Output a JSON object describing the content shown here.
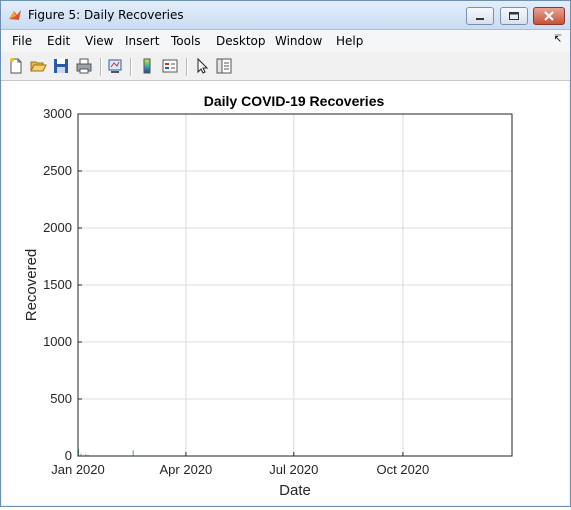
{
  "window": {
    "title": "Figure 5: Daily Recoveries"
  },
  "menu": [
    "File",
    "Edit",
    "View",
    "Insert",
    "Tools",
    "Desktop",
    "Window",
    "Help"
  ],
  "toolbar": {
    "icons": [
      "new-figure-icon",
      "open-file-icon",
      "save-icon",
      "print-icon",
      "link-plot-icon",
      "insert-colorbar-icon",
      "insert-legend-icon",
      "edit-plot-icon",
      "property-inspector-icon"
    ]
  },
  "colors": {
    "bars": "#3cb46e",
    "grid": "#dcdcdc",
    "axes": "#262626"
  },
  "chart_data": {
    "type": "bar",
    "title": "Daily COVID-19 Recoveries",
    "xlabel": "Date",
    "ylabel": "Recovered",
    "ylim": [
      0,
      3000
    ],
    "yticks": [
      0,
      500,
      1000,
      1500,
      2000,
      2500,
      3000
    ],
    "xlim": [
      "2020-01-01",
      "2021-01-01"
    ],
    "xticks": [
      {
        "date": "2020-01-01",
        "label": "Jan 2020"
      },
      {
        "date": "2020-04-01",
        "label": "Apr 2020"
      },
      {
        "date": "2020-07-01",
        "label": "Jul 2020"
      },
      {
        "date": "2020-10-01",
        "label": "Oct 2020"
      }
    ],
    "grid": true,
    "series": [
      {
        "start_date": "2020-01-01",
        "interval": "daily",
        "values": [
          60,
          0,
          20,
          0,
          0,
          0,
          15,
          0,
          10,
          0,
          0,
          0,
          0,
          0,
          0,
          0,
          0,
          0,
          0,
          0,
          0,
          0,
          0,
          0,
          0,
          0,
          0,
          0,
          0,
          0,
          0,
          0,
          0,
          0,
          0,
          0,
          0,
          0,
          0,
          0,
          0,
          0,
          0,
          0,
          0,
          0,
          50,
          0,
          0,
          0,
          0,
          0,
          0,
          0,
          0,
          0,
          0,
          0,
          0,
          0,
          0,
          0,
          0,
          0,
          0,
          0,
          0,
          0,
          0,
          0,
          0,
          0,
          0,
          0,
          0,
          0,
          0,
          0,
          0,
          0,
          0,
          0,
          0,
          0,
          0,
          0,
          0,
          0,
          0,
          0,
          0,
          0,
          0,
          0,
          0,
          0,
          0,
          0,
          0,
          0,
          0,
          0,
          0,
          0,
          0,
          0,
          0,
          0,
          0,
          0,
          0,
          0,
          0,
          0,
          0,
          0,
          0,
          0,
          0,
          0,
          0,
          0,
          0,
          0,
          0,
          0,
          0,
          0,
          0,
          0,
          0,
          0,
          0,
          0,
          0,
          0,
          0,
          0,
          0,
          0,
          0,
          0,
          0,
          0,
          0,
          0,
          0,
          0,
          0,
          0,
          0,
          0,
          0,
          0,
          0,
          0,
          0,
          0,
          0,
          0,
          0,
          0,
          0,
          0,
          0,
          0,
          0,
          0,
          0,
          0,
          0,
          0,
          0,
          0,
          0,
          0,
          0,
          0,
          0,
          0,
          0,
          0,
          0,
          0,
          0,
          0,
          0,
          0,
          0,
          0,
          0,
          0,
          0,
          0,
          0,
          0,
          0,
          0,
          0,
          0,
          0,
          0,
          0,
          0,
          0,
          0,
          0,
          0,
          0,
          0,
          0,
          0,
          0,
          0,
          0,
          0,
          0,
          0,
          0,
          0,
          0,
          0,
          0,
          0,
          0,
          0,
          0,
          0,
          0,
          0,
          0,
          0,
          0,
          0,
          0,
          0,
          0,
          0,
          0,
          0,
          0,
          0,
          0,
          0,
          0,
          0,
          0,
          0,
          0,
          0,
          0,
          0,
          0,
          0,
          0,
          0,
          0,
          0,
          0,
          0,
          0,
          0,
          0,
          0,
          0,
          0,
          0,
          0,
          0,
          0,
          0,
          0,
          0,
          0,
          0,
          0,
          0,
          0,
          0,
          0,
          0,
          0,
          0,
          0,
          0,
          0,
          0,
          0,
          0,
          0,
          0,
          0,
          0,
          0,
          0,
          0,
          0,
          0,
          0,
          0,
          0,
          0,
          0,
          0,
          0,
          0,
          0,
          0,
          0,
          0,
          0,
          0,
          0,
          0,
          0,
          0,
          0,
          0,
          0,
          0,
          0,
          0,
          0,
          0,
          0,
          0,
          0,
          0,
          0,
          0,
          0,
          0,
          0,
          0,
          0,
          0,
          0,
          0,
          0,
          0,
          0,
          0,
          0,
          0,
          0,
          0,
          0,
          0,
          0,
          0,
          0,
          0,
          0,
          0,
          0,
          0,
          0,
          0,
          0,
          0,
          0,
          0,
          0,
          0,
          0,
          0,
          0,
          0,
          0,
          0,
          0,
          0,
          0,
          0,
          0,
          0,
          0,
          0,
          0,
          0,
          0
        ]
      }
    ]
  }
}
